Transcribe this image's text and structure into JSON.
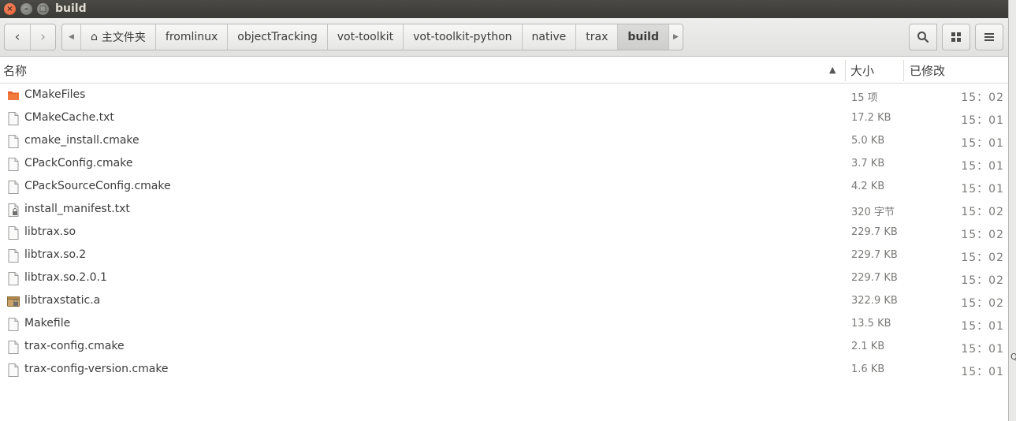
{
  "window": {
    "title": "build",
    "close_glyph": "×",
    "min_glyph": "–",
    "max_glyph": "□"
  },
  "toolbar": {
    "back_glyph": "‹",
    "forward_glyph": "›",
    "path_left_glyph": "◀",
    "path_right_glyph": "▶",
    "home_glyph": "⌂",
    "breadcrumbs": [
      "主文件夹",
      "fromlinux",
      "objectTracking",
      "vot-toolkit",
      "vot-toolkit-python",
      "native",
      "trax",
      "build"
    ],
    "search_icon": "search-icon",
    "grid_icon": "view-grid-icon",
    "menu_icon": "menu-icon"
  },
  "columns": {
    "name": "名称",
    "size": "大小",
    "modified": "已修改",
    "sort_glyph": "▲"
  },
  "files": [
    {
      "name": "CMakeFiles",
      "size": "15 项",
      "time": "15：02",
      "icon": "folder-icon"
    },
    {
      "name": "CMakeCache.txt",
      "size": "17.2 KB",
      "time": "15：01",
      "icon": "text-file-icon"
    },
    {
      "name": "cmake_install.cmake",
      "size": "5.0 KB",
      "time": "15：01",
      "icon": "text-file-icon"
    },
    {
      "name": "CPackConfig.cmake",
      "size": "3.7 KB",
      "time": "15：01",
      "icon": "text-file-icon"
    },
    {
      "name": "CPackSourceConfig.cmake",
      "size": "4.2 KB",
      "time": "15：01",
      "icon": "text-file-icon"
    },
    {
      "name": "install_manifest.txt",
      "size": "320 字节",
      "time": "15：02",
      "icon": "locked-file-icon"
    },
    {
      "name": "libtrax.so",
      "size": "229.7 KB",
      "time": "15：02",
      "icon": "text-file-icon"
    },
    {
      "name": "libtrax.so.2",
      "size": "229.7 KB",
      "time": "15：02",
      "icon": "text-file-icon"
    },
    {
      "name": "libtrax.so.2.0.1",
      "size": "229.7 KB",
      "time": "15：02",
      "icon": "text-file-icon"
    },
    {
      "name": "libtraxstatic.a",
      "size": "322.9 KB",
      "time": "15：02",
      "icon": "archive-icon"
    },
    {
      "name": "Makefile",
      "size": "13.5 KB",
      "time": "15：01",
      "icon": "text-file-icon"
    },
    {
      "name": "trax-config.cmake",
      "size": "2.1 KB",
      "time": "15：01",
      "icon": "text-file-icon"
    },
    {
      "name": "trax-config-version.cmake",
      "size": "1.6 KB",
      "time": "15：01",
      "icon": "text-file-icon"
    }
  ],
  "edge_text": "Qt",
  "colors": {
    "folder": "#e8642a",
    "titlebar": "#3f3e3a"
  }
}
